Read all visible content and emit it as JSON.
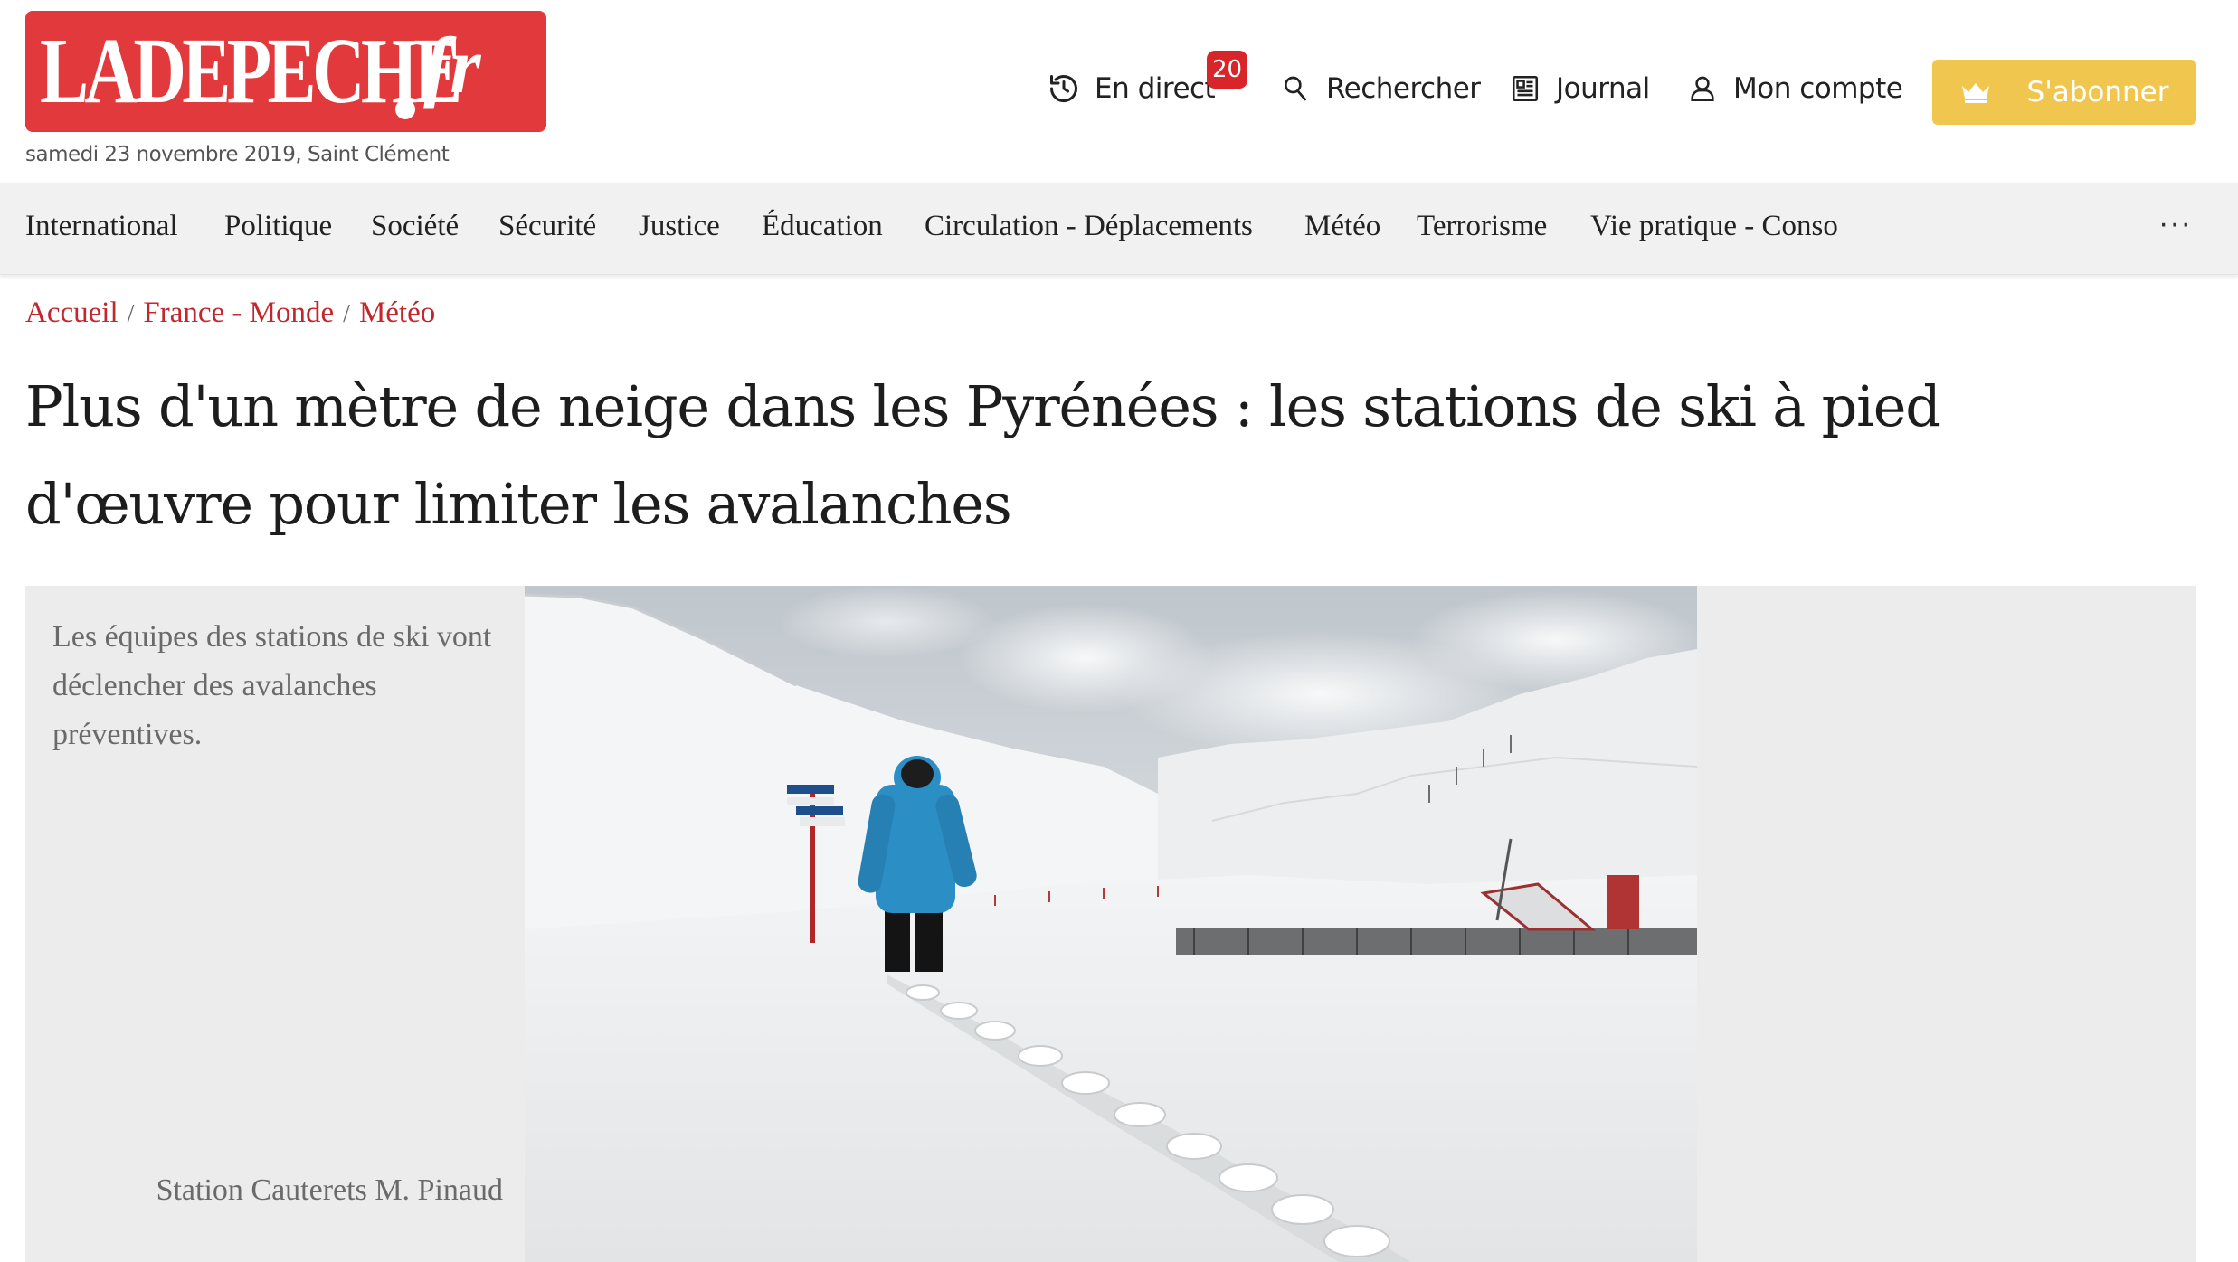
{
  "header": {
    "logo_text": "LADEPECHE",
    "logo_suffix": "fr",
    "date_line": "samedi 23 novembre 2019, Saint Clément",
    "actions": {
      "live_label": "En direct",
      "live_badge": "20",
      "search_label": "Rechercher",
      "journal_label": "Journal",
      "account_label": "Mon compte",
      "subscribe_label": "S'abonner"
    },
    "colors": {
      "brand_red": "#e23a3c",
      "subscribe_yellow": "#f0c64e",
      "badge_red": "#d7252a"
    }
  },
  "nav": {
    "items": [
      "International",
      "Politique",
      "Société",
      "Sécurité",
      "Justice",
      "Éducation",
      "Circulation - Déplacements",
      "Météo",
      "Terrorisme",
      "Vie pratique - Conso"
    ],
    "more_label": "···"
  },
  "breadcrumb": {
    "items": [
      "Accueil",
      "France - Monde",
      "Météo"
    ],
    "separator": "/"
  },
  "article": {
    "title_line1": "Plus d'un mètre de neige dans les Pyrénées : les stations de ski à pied",
    "title_line2": "d'œuvre pour limiter les avalanches",
    "figure": {
      "caption": "Les équipes des stations de ski vont déclencher des avalanches préventives.",
      "credit": "Station Cauterets M. Pinaud"
    }
  }
}
